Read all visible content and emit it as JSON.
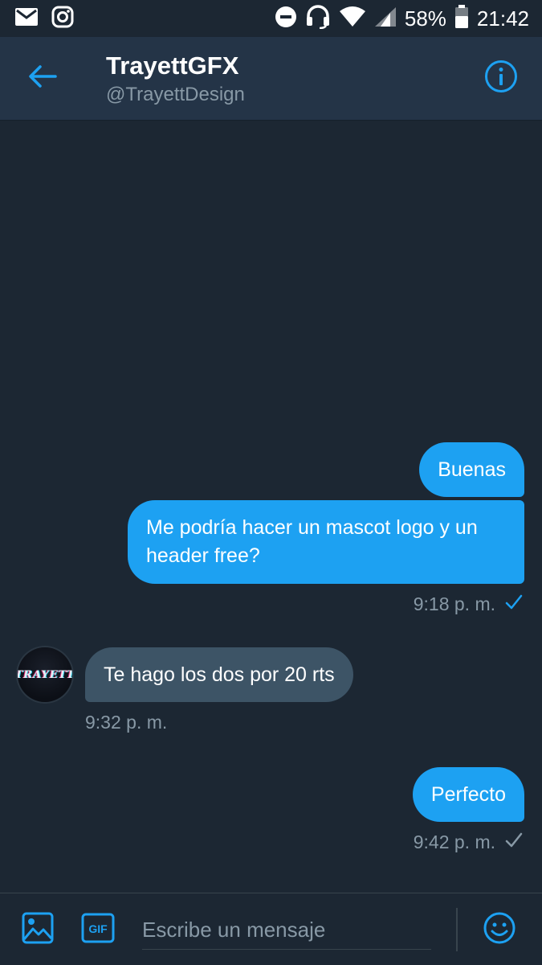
{
  "status_bar": {
    "battery_percent": "58%",
    "time": "21:42",
    "icons": [
      "mail-icon",
      "instagram-icon",
      "do-not-disturb-icon",
      "headset-icon",
      "wifi-icon",
      "cell-signal-icon",
      "battery-icon"
    ]
  },
  "header": {
    "title": "TrayettGFX",
    "handle": "@TrayettDesign",
    "back_icon": "arrow-left-icon",
    "info_icon": "info-icon"
  },
  "messages": [
    {
      "direction": "sent",
      "text": "Buenas"
    },
    {
      "direction": "sent",
      "text": "Me podría hacer un mascot logo y un header free?",
      "time": "9:18 p. m.",
      "status_icon": "check-icon"
    },
    {
      "direction": "received",
      "text": "Te hago los dos por 20 rts",
      "time": "9:32 p. m.",
      "avatar_text": "TRAYETT"
    },
    {
      "direction": "sent",
      "text": "Perfecto",
      "time": "9:42 p. m.",
      "status_icon": "check-icon"
    }
  ],
  "composer": {
    "placeholder": "Escribe un mensaje",
    "gif_label": "GIF",
    "icons": [
      "image-icon",
      "gif-icon",
      "emoji-icon"
    ]
  },
  "colors": {
    "background": "#1c2733",
    "header": "#243447",
    "accent": "#1da1f2",
    "received_bubble": "#3d5466",
    "secondary_text": "#8899a6"
  }
}
